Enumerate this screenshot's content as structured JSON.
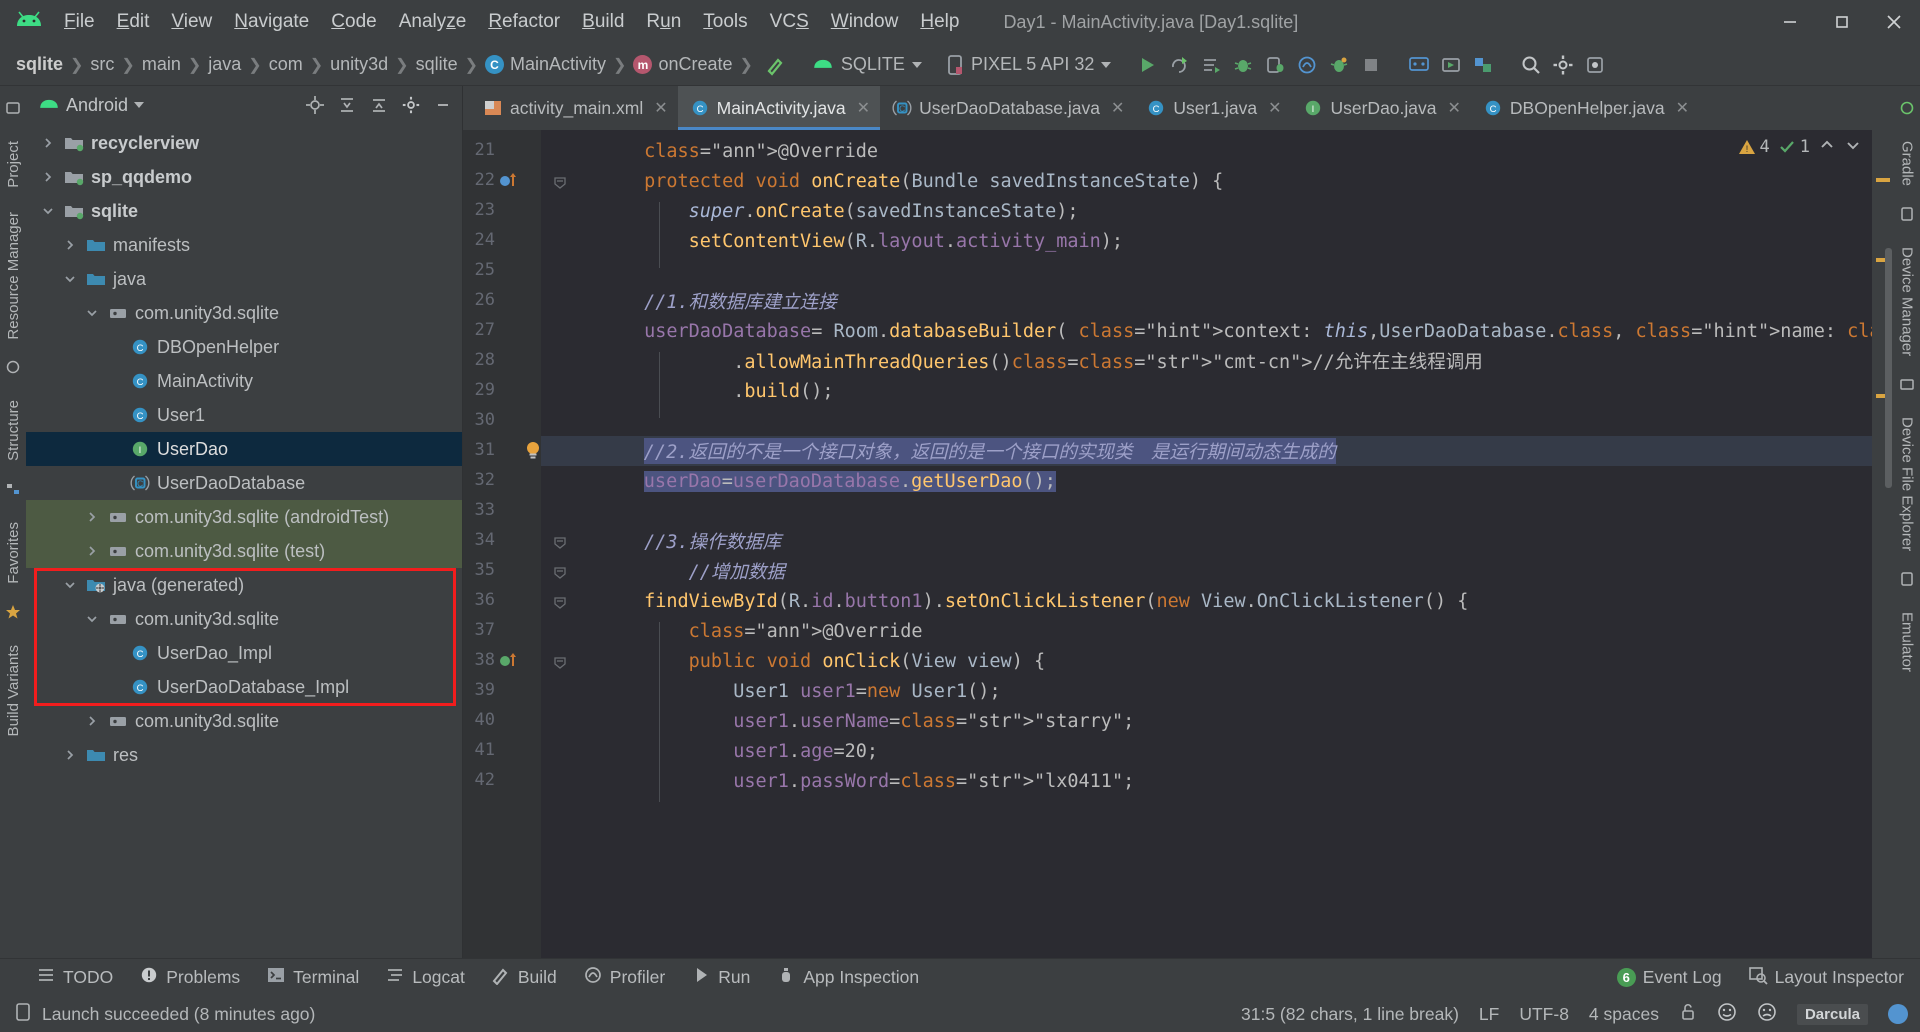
{
  "window": {
    "title": "Day1 - MainActivity.java [Day1.sqlite]",
    "minimize": "—",
    "maximize": "❐",
    "close": "✕"
  },
  "menubar": {
    "items": [
      {
        "label": "File",
        "accel": "F"
      },
      {
        "label": "Edit",
        "accel": "E"
      },
      {
        "label": "View",
        "accel": "V"
      },
      {
        "label": "Navigate",
        "accel": "N"
      },
      {
        "label": "Code",
        "accel": "C"
      },
      {
        "label": "Analyze",
        "accel": "z"
      },
      {
        "label": "Refactor",
        "accel": "R"
      },
      {
        "label": "Build",
        "accel": "B"
      },
      {
        "label": "Run",
        "accel": "u"
      },
      {
        "label": "Tools",
        "accel": "T"
      },
      {
        "label": "VCS",
        "accel": "S"
      },
      {
        "label": "Window",
        "accel": "W"
      },
      {
        "label": "Help",
        "accel": "H"
      }
    ]
  },
  "navbar": {
    "breadcrumbs": [
      "sqlite",
      "src",
      "main",
      "java",
      "com",
      "unity3d",
      "sqlite"
    ],
    "class_crumb": "MainActivity",
    "method_crumb": "onCreate",
    "module_label": "SQLITE",
    "device_label": "PIXEL 5 API 32",
    "icons": {
      "build_hammer": "hammer-icon",
      "android": "android-icon",
      "device": "device-icon",
      "run": "run-icon",
      "rerun": "rerun-icon",
      "apply_changes": "apply-changes-icon",
      "debug": "debug-icon",
      "attach_debugger": "attach-debugger-icon",
      "profiler": "profiler-icon",
      "layout": "layout-icon",
      "stop": "stop-icon",
      "avd": "avd-manager-icon",
      "sdk": "sdk-manager-icon",
      "sync": "gradle-sync-icon",
      "search": "search-icon",
      "settings": "gear-icon",
      "help": "help-icon"
    }
  },
  "left_strip": {
    "items": [
      "Project",
      "Resource Manager",
      "Structure",
      "Favorites",
      "Build Variants"
    ]
  },
  "right_strip": {
    "items": [
      "Gradle",
      "Device Manager",
      "Device File Explorer",
      "Emulator"
    ]
  },
  "project_panel": {
    "title": "Android",
    "icons": [
      "locate-icon",
      "collapse-expand-icon",
      "collapse-all-icon",
      "gear-icon",
      "hide-icon"
    ],
    "tree": [
      {
        "label": "recyclerview",
        "indent": 0,
        "arrow": "right",
        "icon": "module-folder",
        "bold": true,
        "state": "none"
      },
      {
        "label": "sp_qqdemo",
        "indent": 0,
        "arrow": "right",
        "icon": "module-folder",
        "bold": true,
        "state": "none"
      },
      {
        "label": "sqlite",
        "indent": 0,
        "arrow": "down",
        "icon": "module-folder",
        "bold": true,
        "state": "none"
      },
      {
        "label": "manifests",
        "indent": 1,
        "arrow": "right",
        "icon": "folder",
        "bold": false,
        "state": "none"
      },
      {
        "label": "java",
        "indent": 1,
        "arrow": "down",
        "icon": "folder",
        "bold": false,
        "state": "none"
      },
      {
        "label": "com.unity3d.sqlite",
        "indent": 2,
        "arrow": "down",
        "icon": "package",
        "bold": false,
        "state": "none"
      },
      {
        "label": "DBOpenHelper",
        "indent": 3,
        "arrow": "none",
        "icon": "class",
        "bold": false,
        "state": "none"
      },
      {
        "label": "MainActivity",
        "indent": 3,
        "arrow": "none",
        "icon": "class",
        "bold": false,
        "state": "none"
      },
      {
        "label": "User1",
        "indent": 3,
        "arrow": "none",
        "icon": "class",
        "bold": false,
        "state": "none"
      },
      {
        "label": "UserDao",
        "indent": 3,
        "arrow": "none",
        "icon": "interface",
        "bold": false,
        "state": "selected"
      },
      {
        "label": "UserDaoDatabase",
        "indent": 3,
        "arrow": "none",
        "icon": "abstract-class",
        "bold": false,
        "state": "none"
      },
      {
        "label": "com.unity3d.sqlite (androidTest)",
        "indent": 2,
        "arrow": "right",
        "icon": "package",
        "bold": false,
        "state": "test"
      },
      {
        "label": "com.unity3d.sqlite (test)",
        "indent": 2,
        "arrow": "right",
        "icon": "package",
        "bold": false,
        "state": "test"
      },
      {
        "label": "java (generated)",
        "indent": 1,
        "arrow": "down",
        "icon": "generated-folder",
        "bold": false,
        "state": "none"
      },
      {
        "label": "com.unity3d.sqlite",
        "indent": 2,
        "arrow": "down",
        "icon": "package",
        "bold": false,
        "state": "none"
      },
      {
        "label": "UserDao_Impl",
        "indent": 3,
        "arrow": "none",
        "icon": "class",
        "bold": false,
        "state": "none"
      },
      {
        "label": "UserDaoDatabase_Impl",
        "indent": 3,
        "arrow": "none",
        "icon": "class",
        "bold": false,
        "state": "none"
      },
      {
        "label": "com.unity3d.sqlite",
        "indent": 2,
        "arrow": "right",
        "icon": "package",
        "bold": false,
        "state": "none"
      },
      {
        "label": "res",
        "indent": 1,
        "arrow": "right",
        "icon": "folder",
        "bold": false,
        "state": "none"
      }
    ],
    "highlight_box": {
      "from_row": 13,
      "to_row": 16,
      "color": "#f21d1d"
    }
  },
  "editor": {
    "tabs": [
      {
        "label": "activity_main.xml",
        "icon": "xml-layout-icon",
        "active": false
      },
      {
        "label": "MainActivity.java",
        "icon": "class-icon",
        "active": true
      },
      {
        "label": "UserDaoDatabase.java",
        "icon": "abstract-class-icon",
        "active": false
      },
      {
        "label": "User1.java",
        "icon": "class-icon",
        "active": false
      },
      {
        "label": "UserDao.java",
        "icon": "interface-icon",
        "active": false
      },
      {
        "label": "DBOpenHelper.java",
        "icon": "class-icon",
        "active": false
      }
    ],
    "inspection": {
      "warnings": "4",
      "ok": "1",
      "warn_icon": "warning-triangle-icon",
      "ok_icon": "check-icon",
      "up_icon": "chevron-up-icon",
      "down_icon": "chevron-down-icon"
    },
    "first_line_number": 21,
    "lines": [
      {
        "n": 21,
        "indent": 2,
        "text": "@Override"
      },
      {
        "n": 22,
        "indent": 2,
        "text": "protected void onCreate(Bundle savedInstanceState) {",
        "marker": "override-method"
      },
      {
        "n": 23,
        "indent": 3,
        "text": "super.onCreate(savedInstanceState);"
      },
      {
        "n": 24,
        "indent": 3,
        "text": "setContentView(R.layout.activity_main);"
      },
      {
        "n": 25,
        "indent": 0,
        "text": ""
      },
      {
        "n": 26,
        "indent": 2,
        "text": "//1.和数据库建立连接"
      },
      {
        "n": 27,
        "indent": 2,
        "text": "userDaoDatabase= Room.databaseBuilder( context: this,UserDaoDatabase.class, name: \"Mytest\")"
      },
      {
        "n": 28,
        "indent": 4,
        "text": ".allowMainThreadQueries()//允许在主线程调用"
      },
      {
        "n": 29,
        "indent": 4,
        "text": ".build();"
      },
      {
        "n": 30,
        "indent": 0,
        "text": ""
      },
      {
        "n": 31,
        "indent": 2,
        "text": "//2.返回的不是一个接口对象，返回的是一个接口的实现类　是运行期间动态生成的",
        "bulb": true,
        "current": true
      },
      {
        "n": 32,
        "indent": 2,
        "text": "userDao=userDaoDatabase.getUserDao();",
        "selected": true
      },
      {
        "n": 33,
        "indent": 0,
        "text": ""
      },
      {
        "n": 34,
        "indent": 2,
        "text": "//3.操作数据库"
      },
      {
        "n": 35,
        "indent": 3,
        "text": "//增加数据"
      },
      {
        "n": 36,
        "indent": 2,
        "text": "findViewById(R.id.button1).setOnClickListener(new View.OnClickListener() {"
      },
      {
        "n": 37,
        "indent": 3,
        "text": "@Override"
      },
      {
        "n": 38,
        "indent": 3,
        "text": "public void onClick(View view) {",
        "marker": "implements-method"
      },
      {
        "n": 39,
        "indent": 4,
        "text": "User1 user1=new User1();"
      },
      {
        "n": 40,
        "indent": 4,
        "text": "user1.userName=\"starry\";"
      },
      {
        "n": 41,
        "indent": 4,
        "text": "user1.age=20;"
      },
      {
        "n": 42,
        "indent": 4,
        "text": "user1.passWord=\"lx0411\";"
      }
    ]
  },
  "tool_window_bar": {
    "left": [
      {
        "label": "TODO",
        "icon": "todo-icon"
      },
      {
        "label": "Problems",
        "icon": "problems-icon"
      },
      {
        "label": "Terminal",
        "icon": "terminal-icon"
      },
      {
        "label": "Logcat",
        "icon": "logcat-icon"
      },
      {
        "label": "Build",
        "icon": "build-hammer-icon"
      },
      {
        "label": "Profiler",
        "icon": "profiler-icon"
      },
      {
        "label": "Run",
        "icon": "run-icon"
      },
      {
        "label": "App Inspection",
        "icon": "app-inspection-icon"
      }
    ],
    "right": [
      {
        "label": "Event Log",
        "icon": "event-log-icon",
        "badge": "6"
      },
      {
        "label": "Layout Inspector",
        "icon": "layout-inspector-icon",
        "badge": ""
      }
    ]
  },
  "statusbar": {
    "message": "Launch succeeded (8 minutes ago)",
    "caret": "31:5 (82 chars, 1 line break)",
    "line_sep": "LF",
    "encoding": "UTF-8",
    "indent": "4 spaces",
    "theme": "Darcula",
    "icons": [
      "device-icon",
      "lock-open-icon",
      "smiley-happy-icon",
      "smiley-sad-icon"
    ]
  },
  "colors": {
    "chrome": "#3c3f41",
    "editor_bg": "#2b2b31",
    "accent": "#4a88c7",
    "selection": "#0d293e",
    "test_source": "#4d5a43",
    "highlight_red": "#f21d1d",
    "green_badge": "#499c54"
  }
}
